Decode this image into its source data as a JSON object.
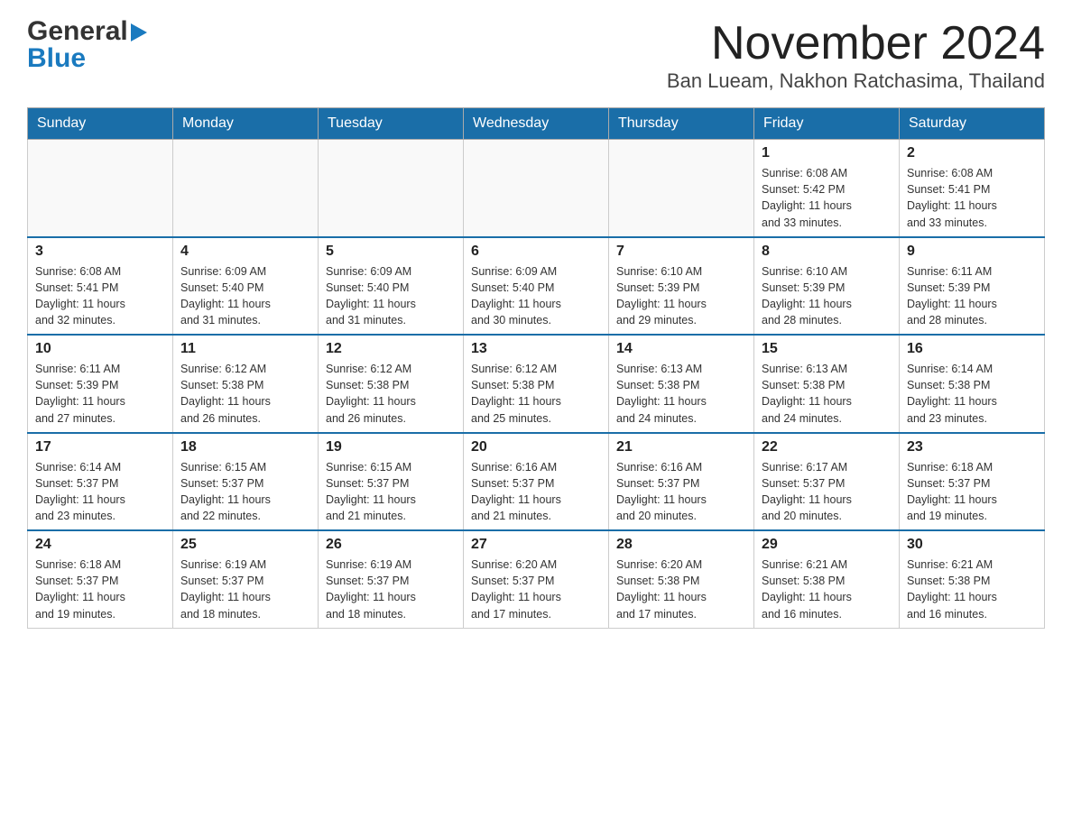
{
  "header": {
    "logo_general": "General",
    "logo_blue": "Blue",
    "title": "November 2024",
    "subtitle": "Ban Lueam, Nakhon Ratchasima, Thailand"
  },
  "calendar": {
    "days": [
      "Sunday",
      "Monday",
      "Tuesday",
      "Wednesday",
      "Thursday",
      "Friday",
      "Saturday"
    ],
    "weeks": [
      [
        {
          "day": "",
          "info": ""
        },
        {
          "day": "",
          "info": ""
        },
        {
          "day": "",
          "info": ""
        },
        {
          "day": "",
          "info": ""
        },
        {
          "day": "",
          "info": ""
        },
        {
          "day": "1",
          "info": "Sunrise: 6:08 AM\nSunset: 5:42 PM\nDaylight: 11 hours\nand 33 minutes."
        },
        {
          "day": "2",
          "info": "Sunrise: 6:08 AM\nSunset: 5:41 PM\nDaylight: 11 hours\nand 33 minutes."
        }
      ],
      [
        {
          "day": "3",
          "info": "Sunrise: 6:08 AM\nSunset: 5:41 PM\nDaylight: 11 hours\nand 32 minutes."
        },
        {
          "day": "4",
          "info": "Sunrise: 6:09 AM\nSunset: 5:40 PM\nDaylight: 11 hours\nand 31 minutes."
        },
        {
          "day": "5",
          "info": "Sunrise: 6:09 AM\nSunset: 5:40 PM\nDaylight: 11 hours\nand 31 minutes."
        },
        {
          "day": "6",
          "info": "Sunrise: 6:09 AM\nSunset: 5:40 PM\nDaylight: 11 hours\nand 30 minutes."
        },
        {
          "day": "7",
          "info": "Sunrise: 6:10 AM\nSunset: 5:39 PM\nDaylight: 11 hours\nand 29 minutes."
        },
        {
          "day": "8",
          "info": "Sunrise: 6:10 AM\nSunset: 5:39 PM\nDaylight: 11 hours\nand 28 minutes."
        },
        {
          "day": "9",
          "info": "Sunrise: 6:11 AM\nSunset: 5:39 PM\nDaylight: 11 hours\nand 28 minutes."
        }
      ],
      [
        {
          "day": "10",
          "info": "Sunrise: 6:11 AM\nSunset: 5:39 PM\nDaylight: 11 hours\nand 27 minutes."
        },
        {
          "day": "11",
          "info": "Sunrise: 6:12 AM\nSunset: 5:38 PM\nDaylight: 11 hours\nand 26 minutes."
        },
        {
          "day": "12",
          "info": "Sunrise: 6:12 AM\nSunset: 5:38 PM\nDaylight: 11 hours\nand 26 minutes."
        },
        {
          "day": "13",
          "info": "Sunrise: 6:12 AM\nSunset: 5:38 PM\nDaylight: 11 hours\nand 25 minutes."
        },
        {
          "day": "14",
          "info": "Sunrise: 6:13 AM\nSunset: 5:38 PM\nDaylight: 11 hours\nand 24 minutes."
        },
        {
          "day": "15",
          "info": "Sunrise: 6:13 AM\nSunset: 5:38 PM\nDaylight: 11 hours\nand 24 minutes."
        },
        {
          "day": "16",
          "info": "Sunrise: 6:14 AM\nSunset: 5:38 PM\nDaylight: 11 hours\nand 23 minutes."
        }
      ],
      [
        {
          "day": "17",
          "info": "Sunrise: 6:14 AM\nSunset: 5:37 PM\nDaylight: 11 hours\nand 23 minutes."
        },
        {
          "day": "18",
          "info": "Sunrise: 6:15 AM\nSunset: 5:37 PM\nDaylight: 11 hours\nand 22 minutes."
        },
        {
          "day": "19",
          "info": "Sunrise: 6:15 AM\nSunset: 5:37 PM\nDaylight: 11 hours\nand 21 minutes."
        },
        {
          "day": "20",
          "info": "Sunrise: 6:16 AM\nSunset: 5:37 PM\nDaylight: 11 hours\nand 21 minutes."
        },
        {
          "day": "21",
          "info": "Sunrise: 6:16 AM\nSunset: 5:37 PM\nDaylight: 11 hours\nand 20 minutes."
        },
        {
          "day": "22",
          "info": "Sunrise: 6:17 AM\nSunset: 5:37 PM\nDaylight: 11 hours\nand 20 minutes."
        },
        {
          "day": "23",
          "info": "Sunrise: 6:18 AM\nSunset: 5:37 PM\nDaylight: 11 hours\nand 19 minutes."
        }
      ],
      [
        {
          "day": "24",
          "info": "Sunrise: 6:18 AM\nSunset: 5:37 PM\nDaylight: 11 hours\nand 19 minutes."
        },
        {
          "day": "25",
          "info": "Sunrise: 6:19 AM\nSunset: 5:37 PM\nDaylight: 11 hours\nand 18 minutes."
        },
        {
          "day": "26",
          "info": "Sunrise: 6:19 AM\nSunset: 5:37 PM\nDaylight: 11 hours\nand 18 minutes."
        },
        {
          "day": "27",
          "info": "Sunrise: 6:20 AM\nSunset: 5:37 PM\nDaylight: 11 hours\nand 17 minutes."
        },
        {
          "day": "28",
          "info": "Sunrise: 6:20 AM\nSunset: 5:38 PM\nDaylight: 11 hours\nand 17 minutes."
        },
        {
          "day": "29",
          "info": "Sunrise: 6:21 AM\nSunset: 5:38 PM\nDaylight: 11 hours\nand 16 minutes."
        },
        {
          "day": "30",
          "info": "Sunrise: 6:21 AM\nSunset: 5:38 PM\nDaylight: 11 hours\nand 16 minutes."
        }
      ]
    ]
  }
}
